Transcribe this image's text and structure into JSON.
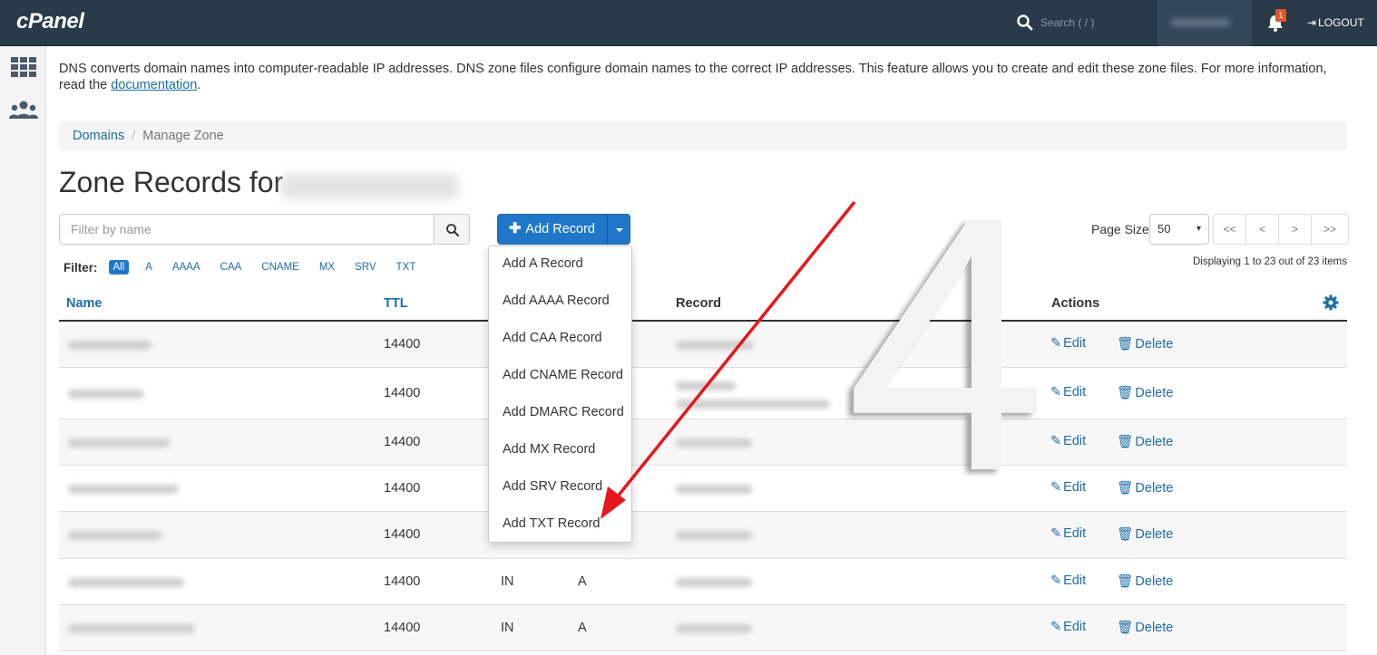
{
  "topbar": {
    "logo": "cPanel",
    "search_placeholder": "Search ( / )",
    "notification_count": "1",
    "logout_label": "LOGOUT"
  },
  "intro": {
    "text": "DNS converts domain names into computer-readable IP addresses. DNS zone files configure domain names to the correct IP addresses. This feature allows you to create and edit these zone files. For more information, read the ",
    "link": "documentation",
    "end": "."
  },
  "breadcrumb": {
    "root": "Domains",
    "separator": "/",
    "current": "Manage Zone"
  },
  "title": "Zone Records for",
  "filter_input_placeholder": "Filter by name",
  "add_record_label": "Add Record",
  "page_size": {
    "label": "Page Size",
    "value": "50"
  },
  "pager": [
    "<<",
    "<",
    ">",
    ">>"
  ],
  "filters": {
    "label": "Filter:",
    "chips": [
      "All",
      "A",
      "AAAA",
      "CAA",
      "CNAME",
      "MX",
      "SRV",
      "TXT"
    ]
  },
  "display_count": "Displaying 1 to 23 out of 23 items",
  "table": {
    "headers": {
      "name": "Name",
      "ttl": "TTL",
      "record": "Record",
      "actions": "Actions"
    },
    "rows": [
      {
        "ttl": "14400",
        "class": "",
        "type": ""
      },
      {
        "ttl": "14400",
        "class": "",
        "type": ""
      },
      {
        "ttl": "14400",
        "class": "",
        "type": ""
      },
      {
        "ttl": "14400",
        "class": "",
        "type": ""
      },
      {
        "ttl": "14400",
        "class": "",
        "type": ""
      },
      {
        "ttl": "14400",
        "class": "IN",
        "type": "A"
      },
      {
        "ttl": "14400",
        "class": "IN",
        "type": "A"
      }
    ],
    "edit_label": "Edit",
    "delete_label": "Delete"
  },
  "add_menu": [
    "Add A Record",
    "Add AAAA Record",
    "Add CAA Record",
    "Add CNAME Record",
    "Add DMARC Record",
    "Add MX Record",
    "Add SRV Record",
    "Add TXT Record"
  ],
  "annotation": {
    "step_number": "4",
    "arrow_color": "#e8161b"
  }
}
